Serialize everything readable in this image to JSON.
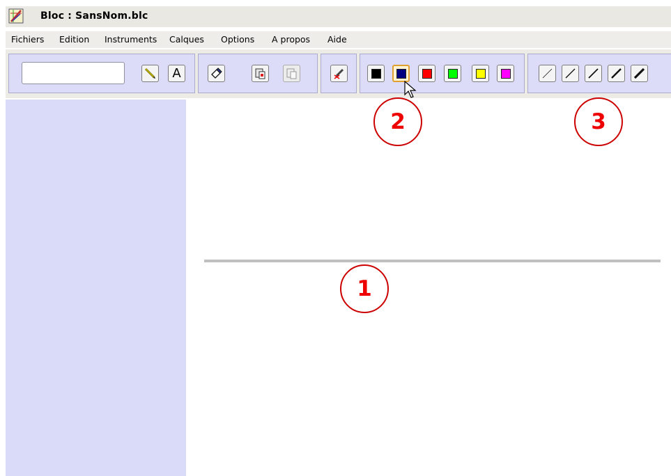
{
  "window": {
    "title": "Bloc : SansNom.blc",
    "icon": "drawing-app-icon"
  },
  "menu": {
    "items": [
      "Fichiers",
      "Edition",
      "Instruments",
      "Calques",
      "Options",
      "A propos",
      "Aide"
    ]
  },
  "toolbar": {
    "text_input": {
      "value": "",
      "placeholder": ""
    },
    "tools": [
      {
        "name": "pencil",
        "icon": "pencil-icon"
      },
      {
        "name": "text",
        "icon": "text-icon",
        "label": "A"
      },
      {
        "name": "eraser",
        "icon": "eraser-icon"
      },
      {
        "name": "paste",
        "icon": "paste-icon"
      },
      {
        "name": "paste-disabled",
        "icon": "paste-disabled-icon"
      },
      {
        "name": "clear",
        "icon": "clear-marker-icon"
      }
    ],
    "colors": [
      {
        "name": "black",
        "hex": "#000000"
      },
      {
        "name": "navy",
        "hex": "#000080",
        "selected": true
      },
      {
        "name": "red",
        "hex": "#ff0000"
      },
      {
        "name": "green",
        "hex": "#00ff00"
      },
      {
        "name": "yellow",
        "hex": "#ffff00"
      },
      {
        "name": "magenta",
        "hex": "#ff00ff"
      }
    ],
    "line_widths": [
      1,
      2,
      3,
      4,
      5
    ]
  },
  "annotations": {
    "callout_1": "1",
    "callout_2": "2",
    "callout_3": "3",
    "color": "#ee0000"
  },
  "theme": {
    "panel_color": "#dadaf9",
    "toolbar_group_color": "#dcdcf8",
    "line_color": "#c0c0c0"
  }
}
